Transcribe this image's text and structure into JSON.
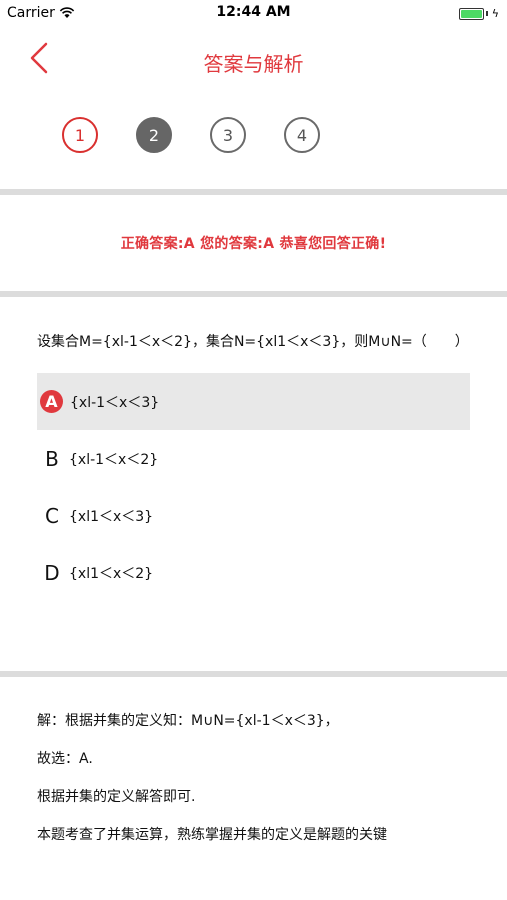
{
  "status_bar": {
    "carrier": "Carrier",
    "time": "12:44 AM",
    "battery_level": 1.0,
    "charging_symbol": "ϟ"
  },
  "nav": {
    "title": "答案与解析",
    "back_icon": "chevron-left-icon"
  },
  "steps": [
    {
      "label": "1",
      "state": "correct"
    },
    {
      "label": "2",
      "state": "current"
    },
    {
      "label": "3",
      "state": "normal"
    },
    {
      "label": "4",
      "state": "normal"
    }
  ],
  "result": {
    "text": "正确答案:A  您的答案:A  恭喜您回答正确!"
  },
  "question": {
    "text": "设集合M={xl-1＜x＜2}，集合N={xl1＜x＜3}，则M∪N=（　　）",
    "options": [
      {
        "letter": "A",
        "text": "{xl-1＜x＜3}",
        "selected": true
      },
      {
        "letter": "B",
        "text": "{xl-1＜x＜2}",
        "selected": false
      },
      {
        "letter": "C",
        "text": "{xl1＜x＜3}",
        "selected": false
      },
      {
        "letter": "D",
        "text": "{xl1＜x＜2}",
        "selected": false
      }
    ]
  },
  "explanation": {
    "lines": [
      "解：根据并集的定义知：M∪N={xl-1＜x＜3}，",
      "故选：A.",
      "根据并集的定义解答即可.",
      "本题考查了并集运算，熟练掌握并集的定义是解题的关键"
    ]
  },
  "colors": {
    "accent": "#e0393e",
    "current_step": "#666666",
    "selected_bg": "#e8e8e8",
    "divider": "#dcdcdc"
  }
}
